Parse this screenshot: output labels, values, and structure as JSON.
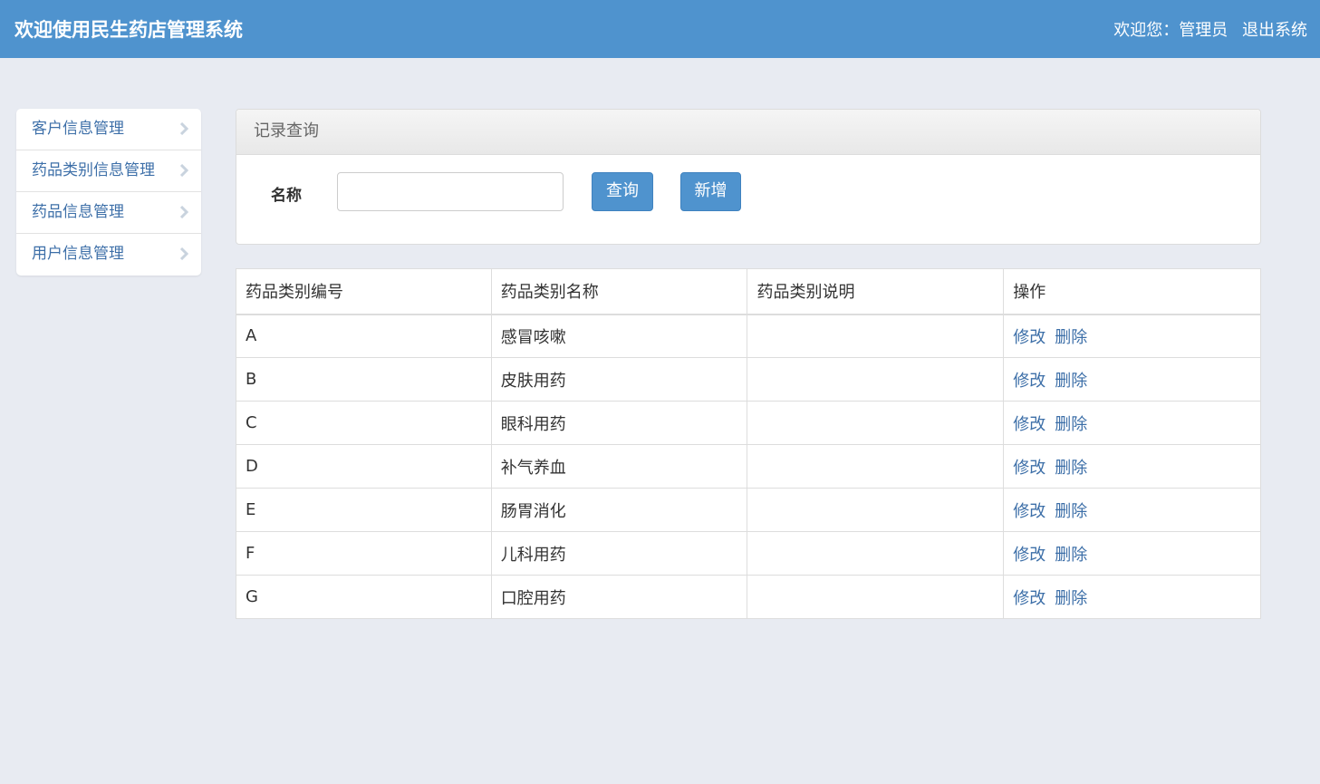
{
  "header": {
    "title": "欢迎使用民生药店管理系统",
    "welcome": "欢迎您：",
    "username": "管理员",
    "logout": "退出系统"
  },
  "sidebar": {
    "items": [
      {
        "label": "客户信息管理",
        "icon": "chevron-right-icon"
      },
      {
        "label": "药品类别信息管理",
        "icon": "chevron-right-icon"
      },
      {
        "label": "药品信息管理",
        "icon": "chevron-right-icon"
      },
      {
        "label": "用户信息管理",
        "icon": "chevron-right-icon"
      }
    ]
  },
  "query_panel": {
    "title": "记录查询",
    "name_label": "名称",
    "name_value": "",
    "search_button": "查询",
    "add_button": "新增"
  },
  "table": {
    "headers": [
      "药品类别编号",
      "药品类别名称",
      "药品类别说明",
      "操作"
    ],
    "rows": [
      {
        "id": "A",
        "name": "感冒咳嗽",
        "desc": ""
      },
      {
        "id": "B",
        "name": "皮肤用药",
        "desc": ""
      },
      {
        "id": "C",
        "name": "眼科用药",
        "desc": ""
      },
      {
        "id": "D",
        "name": "补气养血",
        "desc": ""
      },
      {
        "id": "E",
        "name": "肠胃消化",
        "desc": ""
      },
      {
        "id": "F",
        "name": "儿科用药",
        "desc": ""
      },
      {
        "id": "G",
        "name": "口腔用药",
        "desc": ""
      }
    ],
    "edit_label": "修改",
    "delete_label": "删除"
  },
  "colors": {
    "header_bg": "#4f93ce",
    "page_bg": "#e8ebf2",
    "link": "#3d6fa8"
  }
}
